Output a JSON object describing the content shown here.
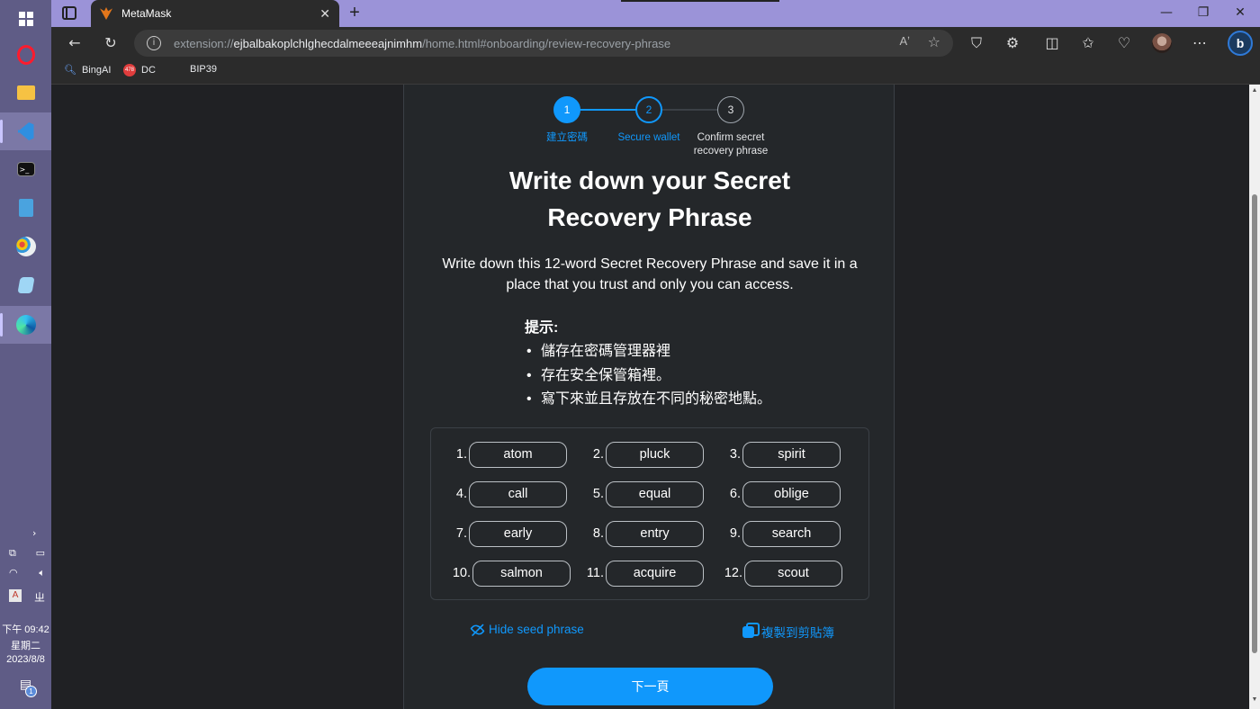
{
  "browser": {
    "tab_title": "MetaMask",
    "url_scheme": "extension://",
    "url_host": "ejbalbakoplchlghecdalmeeeajnimhm",
    "url_path": "/home.html#onboarding/review-recovery-phrase",
    "read_aloud": "Aʼ",
    "bookmarks": [
      {
        "label": "BingAI",
        "icon": "search-icon"
      },
      {
        "label": "DC",
        "icon": "discord-badge-icon",
        "badge": "478"
      },
      {
        "label": "BIP39",
        "icon": ""
      }
    ]
  },
  "taskbar": {
    "clock_line1": "下午 09:42",
    "clock_line2": "星期二",
    "clock_line3": "2023/8/8",
    "notification_count": "1",
    "ime_label": "ㄓ",
    "ime_alt": "A"
  },
  "stepper": {
    "steps": [
      {
        "number": "1",
        "label": "建立密碼",
        "state": "done"
      },
      {
        "number": "2",
        "label": "Secure wallet",
        "state": "active"
      },
      {
        "number": "3",
        "label_line1": "Confirm secret",
        "label_line2": "recovery phrase",
        "state": "todo"
      }
    ]
  },
  "heading": {
    "line1": "Write down your Secret",
    "line2": "Recovery Phrase"
  },
  "intro_line1": "Write down this 12-word Secret Recovery Phrase and save it in a",
  "intro_line2": "place that you trust and only you can access.",
  "tips": {
    "title": "提示:",
    "items": [
      "儲存在密碼管理器裡",
      "存在安全保管箱裡。",
      "寫下來並且存放在不同的秘密地點。"
    ]
  },
  "seed_words": [
    {
      "num": "1.",
      "word": "atom"
    },
    {
      "num": "2.",
      "word": "pluck"
    },
    {
      "num": "3.",
      "word": "spirit"
    },
    {
      "num": "4.",
      "word": "call"
    },
    {
      "num": "5.",
      "word": "equal"
    },
    {
      "num": "6.",
      "word": "oblige"
    },
    {
      "num": "7.",
      "word": "early"
    },
    {
      "num": "8.",
      "word": "entry"
    },
    {
      "num": "9.",
      "word": "search"
    },
    {
      "num": "10.",
      "word": "salmon"
    },
    {
      "num": "11.",
      "word": "acquire"
    },
    {
      "num": "12.",
      "word": "scout"
    }
  ],
  "actions": {
    "hide_seed": "Hide seed phrase",
    "copy": "複製到剪貼簿",
    "next": "下一頁"
  },
  "colors": {
    "accent": "#1098fc",
    "card_bg": "#24272a",
    "taskbar": "#5f5c86",
    "tabbar": "#9b93d8"
  }
}
